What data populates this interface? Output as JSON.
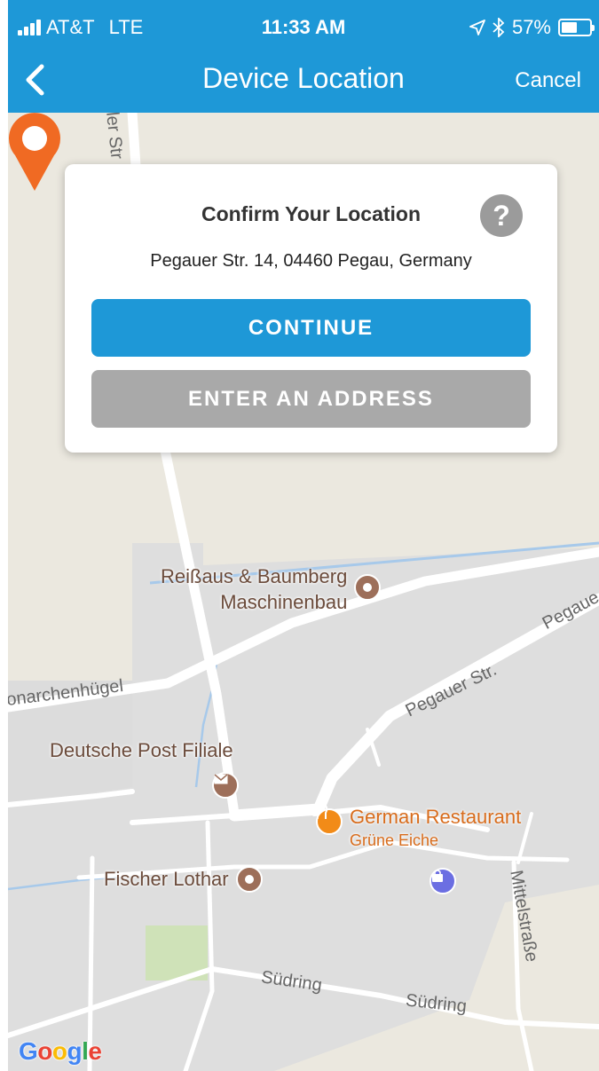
{
  "status_bar": {
    "carrier": "AT&T",
    "network": "LTE",
    "time": "11:33 AM",
    "battery": "57%",
    "battery_level": 0.57
  },
  "nav": {
    "title": "Device Location",
    "cancel_label": "Cancel"
  },
  "card": {
    "title": "Confirm Your Location",
    "help_icon": "?",
    "address": "Pegauer Str. 14, 04460 Pegau, Germany",
    "continue_label": "CONTINUE",
    "enter_address_label": "ENTER AN ADDRESS"
  },
  "map": {
    "pois": [
      {
        "name_line1": "Reißaus & Baumberg",
        "name_line2": "Maschinenbau",
        "icon": "circle-dot-icon"
      },
      {
        "name": "Deutsche Post Filiale",
        "icon": "mail-icon"
      },
      {
        "name_line1": "German Restaurant",
        "name_line2": "Grüne Eiche",
        "icon": "restaurant-icon"
      },
      {
        "name": "Fischer Lothar",
        "icon": "circle-dot-icon"
      },
      {
        "icon": "shopping-bag-icon"
      }
    ],
    "streets": {
      "top_partial": "ler Str",
      "narchenhuegel": "onarchenhügel",
      "pegauer_1": "Pegauer Str.",
      "pegauer_2": "Pegaue",
      "suedring_1": "Südring",
      "suedring_2": "Südring",
      "mittelstrasse": "Mittelstraße"
    },
    "attribution": "Google"
  },
  "colors": {
    "header": "#1e98d7",
    "continue_button": "#1e98d7",
    "enter_button": "#a9a9a9",
    "pin": "#f06a23"
  }
}
